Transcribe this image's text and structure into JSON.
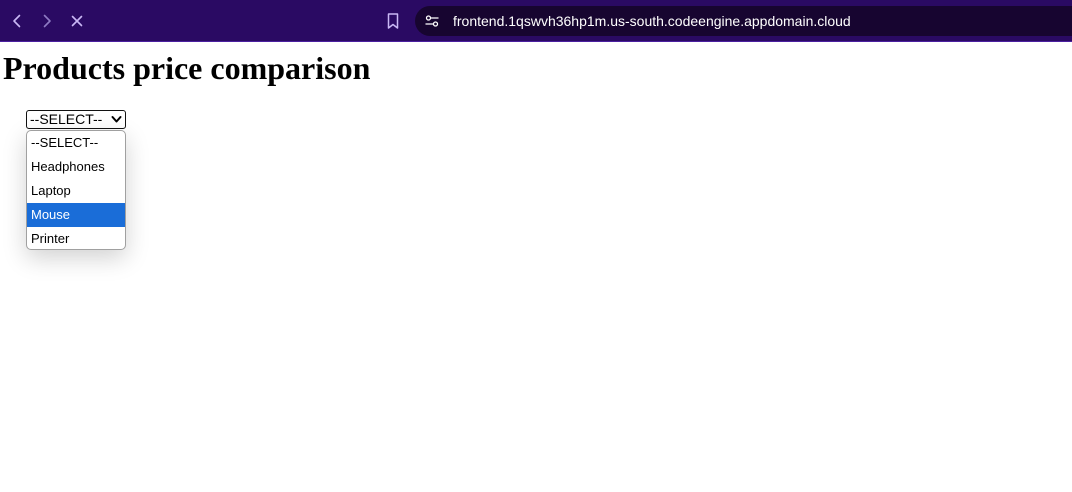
{
  "browser": {
    "url": "frontend.1qswvh36hp1m.us-south.codeengine.appdomain.cloud",
    "icons": {
      "back": "chevron-left-icon",
      "forward": "chevron-right-icon",
      "stop": "close-icon",
      "bookmark": "bookmark-icon",
      "site_info": "tune-icon"
    },
    "colors": {
      "toolbar": "#2a0a63",
      "address_bar": "#170530",
      "icon": "#c9b8f5"
    }
  },
  "page": {
    "title": "Products price comparison",
    "select": {
      "current_value": "--SELECT--",
      "options": [
        {
          "label": "--SELECT--"
        },
        {
          "label": "Headphones"
        },
        {
          "label": "Laptop"
        },
        {
          "label": "Mouse",
          "highlighted": true
        },
        {
          "label": "Printer"
        }
      ],
      "highlight_color": "#1a6dd8"
    }
  }
}
